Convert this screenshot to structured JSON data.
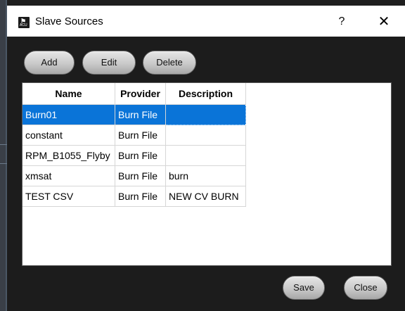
{
  "window": {
    "title": "Slave Sources",
    "help_label": "?",
    "close_glyph": "✕",
    "app_icon": "acu-app-icon"
  },
  "toolbar": {
    "add_label": "Add",
    "edit_label": "Edit",
    "delete_label": "Delete"
  },
  "table": {
    "columns": [
      "Name",
      "Provider",
      "Description"
    ],
    "selected_row": 0,
    "rows": [
      {
        "name": "Burn01",
        "provider": "Burn File",
        "description": ""
      },
      {
        "name": "constant",
        "provider": "Burn File",
        "description": ""
      },
      {
        "name": "RPM_B1055_Flyby",
        "provider": "Burn File",
        "description": ""
      },
      {
        "name": "xmsat",
        "provider": "Burn File",
        "description": "burn"
      },
      {
        "name": "TEST CSV",
        "provider": "Burn File",
        "description": "NEW CV BURN"
      }
    ]
  },
  "footer": {
    "save_label": "Save",
    "close_label": "Close"
  },
  "colors": {
    "selection": "#0a74d8",
    "dialog_bg": "#1c1c1c"
  }
}
